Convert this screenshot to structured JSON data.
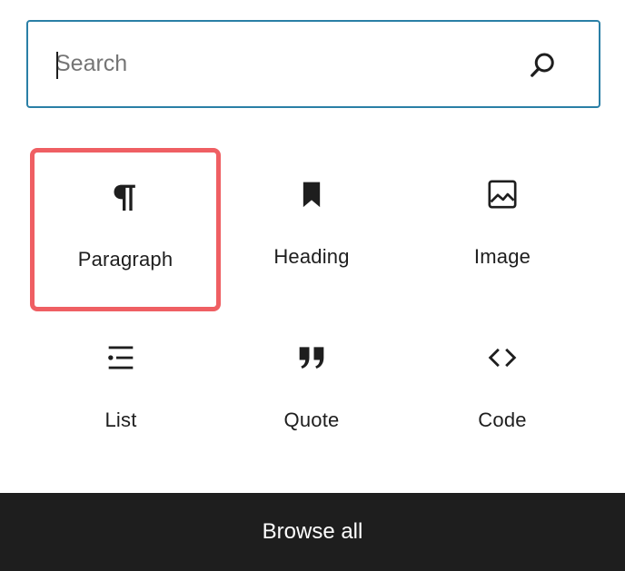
{
  "search": {
    "placeholder": "Search",
    "value": ""
  },
  "blocks": [
    {
      "label": "Paragraph",
      "icon": "paragraph-icon",
      "highlighted": true
    },
    {
      "label": "Heading",
      "icon": "bookmark-icon",
      "highlighted": false
    },
    {
      "label": "Image",
      "icon": "image-icon",
      "highlighted": false
    },
    {
      "label": "List",
      "icon": "list-icon",
      "highlighted": false
    },
    {
      "label": "Quote",
      "icon": "quote-icon",
      "highlighted": false
    },
    {
      "label": "Code",
      "icon": "code-icon",
      "highlighted": false
    }
  ],
  "footer": {
    "browse_label": "Browse all"
  },
  "colors": {
    "focus_border": "#2a7fa6",
    "highlight_border": "#ef5f63",
    "footer_bg": "#1e1e1e"
  }
}
